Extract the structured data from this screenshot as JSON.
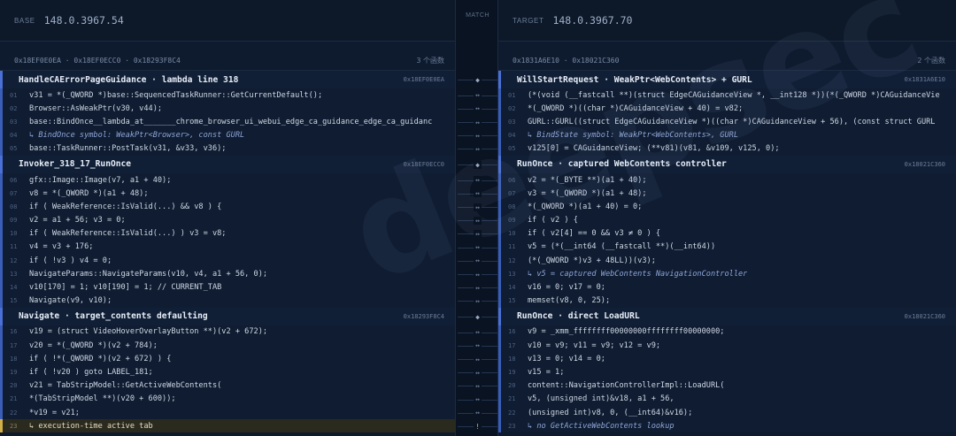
{
  "base": {
    "label": "BASE",
    "version": "148.0.3967.54",
    "range": "0x18EF0E0EA · 0x18EF0ECC0 · 0x18293F8C4",
    "count": "3 个函数"
  },
  "target": {
    "label": "TARGET",
    "version": "148.0.3967.70",
    "range": "0x1831A6E10 · 0x18021C360",
    "count": "2 个函数"
  },
  "match_label": "MATCH",
  "watermark": "deepsec",
  "left_blocks": [
    {
      "title": "HandleCAErrorPageGuidance · lambda line 318",
      "addr": "0x18EF0E0EA",
      "lines": [
        {
          "num": "01",
          "code": "    v31 = *(_QWORD *)base::SequencedTaskRunner::GetCurrentDefault();"
        },
        {
          "num": "02",
          "code": "    Browser::AsWeakPtr(v30, v44);"
        },
        {
          "num": "03",
          "code": "    base::BindOnce__lambda_at_______chrome_browser_ui_webui_edge_ca_guidance_edge_ca_guidanc"
        },
        {
          "num": "04",
          "code": "    ↳ BindOnce symbol: WeakPtr<Browser>, const GURL",
          "note": true
        },
        {
          "num": "05",
          "code": "    base::TaskRunner::PostTask(v31, &v33, v36);"
        }
      ]
    },
    {
      "title": "Invoker_318_17_RunOnce",
      "addr": "0x18EF0ECC0",
      "lines": [
        {
          "num": "06",
          "code": "  gfx::Image::Image(v7, a1 + 40);"
        },
        {
          "num": "07",
          "code": "  v8 = *(_QWORD *)(a1 + 48);"
        },
        {
          "num": "08",
          "code": "  if ( WeakReference::IsValid(...) && v8 ) {"
        },
        {
          "num": "09",
          "code": "    v2 = a1 + 56;  v3 = 0;"
        },
        {
          "num": "10",
          "code": "    if ( WeakReference::IsValid(...) ) v3 = v8;"
        },
        {
          "num": "11",
          "code": "    v4 = v3 + 176;"
        },
        {
          "num": "12",
          "code": "    if ( !v3 ) v4 = 0;"
        },
        {
          "num": "13",
          "code": "    NavigateParams::NavigateParams(v10, v4, a1 + 56, 0);"
        },
        {
          "num": "14",
          "code": "    v10[170] = 1;  v10[190] = 1;        // CURRENT_TAB"
        },
        {
          "num": "15",
          "code": "    Navigate(v9, v10);"
        }
      ]
    },
    {
      "title": "Navigate · target_contents defaulting",
      "addr": "0x18293F8C4",
      "lines": [
        {
          "num": "16",
          "code": "  v19 = (struct VideoHoverOverlayButton **)(v2 + 672);"
        },
        {
          "num": "17",
          "code": "  v20 = *(_QWORD *)(v2 + 784);"
        },
        {
          "num": "18",
          "code": "  if ( !*(_QWORD *)(v2 + 672) ) {"
        },
        {
          "num": "19",
          "code": "    if ( !v20 ) goto LABEL_181;"
        },
        {
          "num": "20",
          "code": "    v21 = TabStripModel::GetActiveWebContents("
        },
        {
          "num": "21",
          "code": "      *(TabStripModel **)(v20 + 600));"
        },
        {
          "num": "22",
          "code": "    *v19 = v21;"
        },
        {
          "num": "23",
          "code": "    ↳ execution-time active tab",
          "hl": true
        }
      ]
    }
  ],
  "right_blocks": [
    {
      "title": "WillStartRequest · WeakPtr<WebContents> + GURL",
      "addr": "0x1831A6E10",
      "lines": [
        {
          "num": "01",
          "code": "  (*(void (__fastcall **)(struct EdgeCAGuidanceView *, __int128 *))(*(_QWORD *)CAGuidanceVie"
        },
        {
          "num": "02",
          "code": "  *(_QWORD *)((char *)CAGuidanceView + 40) = v82;"
        },
        {
          "num": "03",
          "code": "  GURL::GURL((struct EdgeCAGuidanceView *)((char *)CAGuidanceView + 56), (const struct GURL"
        },
        {
          "num": "04",
          "code": "  ↳ BindState symbol: WeakPtr<WebContents>, GURL",
          "note": true
        },
        {
          "num": "05",
          "code": "  v125[0] = CAGuidanceView;  (**v81)(v81, &v109, v125, 0);"
        }
      ]
    },
    {
      "title": "RunOnce · captured WebContents controller",
      "addr": "0x18021C360",
      "lines": [
        {
          "num": "06",
          "code": "  v2 = *(_BYTE **)(a1 + 40);"
        },
        {
          "num": "07",
          "code": "  v3 = *(_QWORD *)(a1 + 48);"
        },
        {
          "num": "08",
          "code": "  *(_QWORD *)(a1 + 40) = 0;"
        },
        {
          "num": "09",
          "code": "  if ( v2 ) {"
        },
        {
          "num": "10",
          "code": "    if ( v2[4] == 0 && v3 ≠ 0 ) {"
        },
        {
          "num": "11",
          "code": "      v5 = (*(__int64 (__fastcall **)(__int64))"
        },
        {
          "num": "12",
          "code": "        (*(_QWORD *)v3 + 48LL))(v3);"
        },
        {
          "num": "13",
          "code": "      ↳ v5 = captured WebContents NavigationController",
          "note": true
        },
        {
          "num": "14",
          "code": "      v16 = 0;  v17 = 0;"
        },
        {
          "num": "15",
          "code": "      memset(v8, 0, 25);"
        }
      ]
    },
    {
      "title": "RunOnce · direct LoadURL",
      "addr": "0x18021C360",
      "lines": [
        {
          "num": "16",
          "code": "  v9 = _xmm_ffffffff00000000ffffffff00000000;"
        },
        {
          "num": "17",
          "code": "  v10 = v9;  v11 = v9;  v12 = v9;"
        },
        {
          "num": "18",
          "code": "  v13 = 0;  v14 = 0;"
        },
        {
          "num": "19",
          "code": "  v15 = 1;"
        },
        {
          "num": "20",
          "code": "  content::NavigationControllerImpl::LoadURL("
        },
        {
          "num": "21",
          "code": "    v5, (unsigned int)&v18, a1 + 56,"
        },
        {
          "num": "22",
          "code": "    (unsigned int)v8, 0, (__int64)&v16);"
        },
        {
          "num": "23",
          "code": "  ↳ no GetActiveWebContents lookup",
          "note": true
        }
      ]
    }
  ],
  "gutter_rows": [
    {
      "kind": "title",
      "sym": "◆"
    },
    {
      "sym": "↔"
    },
    {
      "sym": "↔"
    },
    {
      "sym": "↔"
    },
    {
      "sym": "↔"
    },
    {
      "sym": "↔"
    },
    {
      "kind": "title",
      "sym": "◆"
    },
    {
      "sym": "↔"
    },
    {
      "sym": "↔"
    },
    {
      "sym": "↔"
    },
    {
      "sym": "↔"
    },
    {
      "sym": "↔"
    },
    {
      "sym": "↔"
    },
    {
      "sym": "↔"
    },
    {
      "sym": "↔"
    },
    {
      "sym": "↔"
    },
    {
      "sym": "↔"
    },
    {
      "kind": "title",
      "sym": "◆"
    },
    {
      "sym": "↔"
    },
    {
      "sym": "↔"
    },
    {
      "sym": "↔"
    },
    {
      "sym": "↔"
    },
    {
      "sym": "↔"
    },
    {
      "sym": "↔"
    },
    {
      "sym": "↔"
    },
    {
      "kind": "warn",
      "sym": "!"
    }
  ]
}
